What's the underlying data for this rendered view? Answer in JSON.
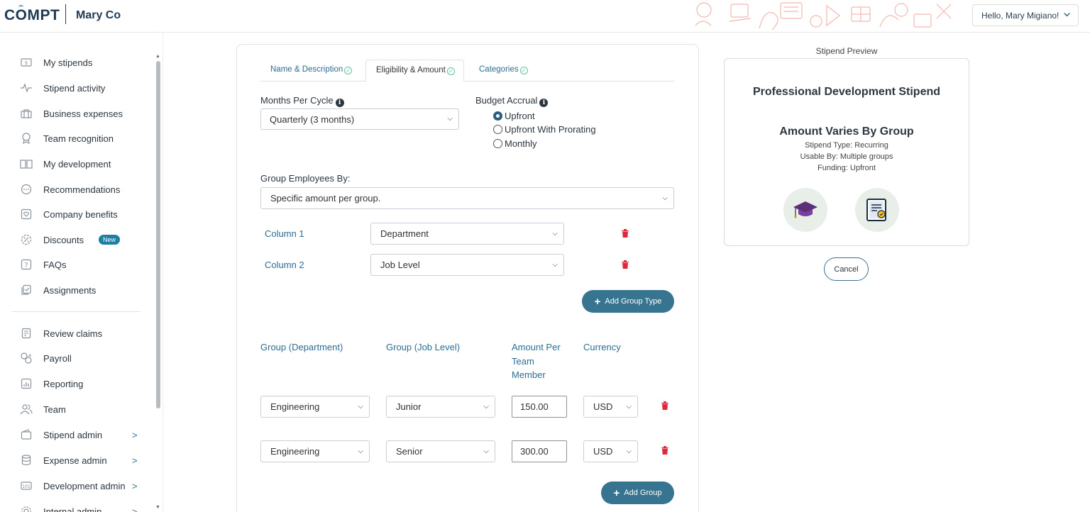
{
  "header": {
    "logo_text": "COMPT",
    "company": "Mary Co",
    "user_greeting": "Hello, Mary Migiano!"
  },
  "sidebar": {
    "items": [
      {
        "label": "My stipends",
        "icon": "dollar-card-icon"
      },
      {
        "label": "Stipend activity",
        "icon": "activity-icon"
      },
      {
        "label": "Business expenses",
        "icon": "briefcase-icon"
      },
      {
        "label": "Team recognition",
        "icon": "award-icon"
      },
      {
        "label": "My development",
        "icon": "book-icon"
      },
      {
        "label": "Recommendations",
        "icon": "chat-icon"
      },
      {
        "label": "Company benefits",
        "icon": "heart-shield-icon"
      },
      {
        "label": "Discounts",
        "icon": "percent-icon",
        "badge": "New"
      },
      {
        "label": "FAQs",
        "icon": "question-icon"
      },
      {
        "label": "Assignments",
        "icon": "checklist-icon"
      }
    ],
    "admin_items": [
      {
        "label": "Review claims",
        "icon": "document-icon"
      },
      {
        "label": "Payroll",
        "icon": "payroll-icon"
      },
      {
        "label": "Reporting",
        "icon": "chart-icon"
      },
      {
        "label": "Team",
        "icon": "team-icon"
      },
      {
        "label": "Stipend admin",
        "icon": "wallet-icon",
        "arrow": ">"
      },
      {
        "label": "Expense admin",
        "icon": "database-icon",
        "arrow": ">"
      },
      {
        "label": "Development admin",
        "icon": "id-card-icon",
        "arrow": ">"
      },
      {
        "label": "Internal admin",
        "icon": "gear-icon",
        "arrow": ">"
      }
    ]
  },
  "tabs": [
    {
      "label": "Name & Description",
      "checked": true
    },
    {
      "label": "Eligibility & Amount",
      "checked": true,
      "active": true
    },
    {
      "label": "Categories",
      "checked": true
    }
  ],
  "form": {
    "months_label": "Months Per Cycle",
    "months_value": "Quarterly (3 months)",
    "accrual_label": "Budget Accrual",
    "accrual_options": [
      {
        "label": "Upfront",
        "selected": true
      },
      {
        "label": "Upfront With Prorating",
        "selected": false
      },
      {
        "label": "Monthly",
        "selected": false
      }
    ],
    "group_by_label": "Group Employees By:",
    "group_by_value": "Specific amount per group.",
    "columns": [
      {
        "label": "Column 1",
        "value": "Department"
      },
      {
        "label": "Column 2",
        "value": "Job Level"
      }
    ],
    "add_group_type": "Add Group Type",
    "table_headers": {
      "dept": "Group (Department)",
      "level": "Group (Job Level)",
      "amount_l1": "Amount Per",
      "amount_l2": "Team",
      "amount_l3": "Member",
      "currency": "Currency"
    },
    "rows": [
      {
        "dept": "Engineering",
        "level": "Junior",
        "amount": "150.00",
        "currency": "USD"
      },
      {
        "dept": "Engineering",
        "level": "Senior",
        "amount": "300.00",
        "currency": "USD"
      }
    ],
    "add_group": "Add Group"
  },
  "preview": {
    "title": "Stipend Preview",
    "name": "Professional Development Stipend",
    "amount": "Amount Varies By Group",
    "type": "Stipend Type: Recurring",
    "usable": "Usable By: Multiple groups",
    "funding": "Funding: Upfront",
    "icons": [
      "graduation-cap-icon",
      "certificate-icon"
    ],
    "cancel": "Cancel"
  },
  "colors": {
    "accent": "#36748f",
    "link": "#2b6e93",
    "check": "#52c7a1",
    "trash": "#e0283c",
    "badge": "#1d7fa3"
  }
}
